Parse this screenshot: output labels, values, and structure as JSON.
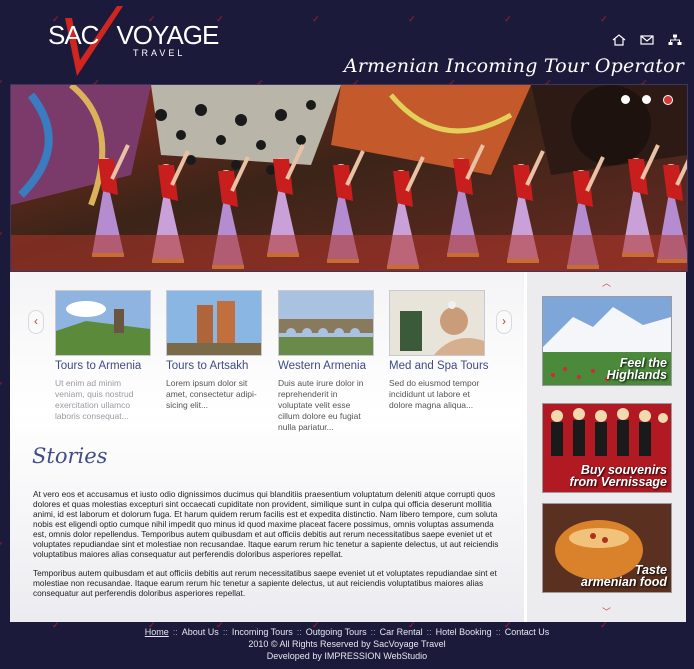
{
  "brand": {
    "name_left": "SAC",
    "name_right": "VOYAGE",
    "sub": "TRAVEL",
    "accent": "#d0261f"
  },
  "watermark_text": "SACVOYAGE",
  "header": {
    "tagline": "Armenian Incoming Tour Operator",
    "icons": [
      "home-icon",
      "mail-icon",
      "sitemap-icon"
    ]
  },
  "slider": {
    "dots": 3,
    "active_dot": 3
  },
  "tours": [
    {
      "title": "Tours to Armenia",
      "desc": "Ut enim ad minim veniam, quis nostrud exercitation ullamco laboris consequat..."
    },
    {
      "title": "Tours to Artsakh",
      "desc": "Lorem ipsum dolor sit amet, consectetur adipi-sicing elit..."
    },
    {
      "title": "Western Armenia",
      "desc": "Duis aute irure dolor in reprehenderit in voluptate velit esse cillum dolore eu fugiat nulla pariatur..."
    },
    {
      "title": "Med and Spa Tours",
      "desc": "Sed do eiusmod tempor incididunt ut labore et dolore magna aliqua..."
    }
  ],
  "stories": {
    "title": "Stories",
    "p1": "At vero eos et accusamus et iusto odio dignissimos ducimus qui blanditiis praesentium voluptatum deleniti atque corrupti quos dolores et quas molestias excepturi sint occaecati cupiditate non provident, similique sunt in culpa qui officia deserunt mollitia animi, id est laborum et dolorum fuga. Et harum quidem rerum facilis est et expedita distinctio. Nam libero tempore, cum soluta nobis est eligendi optio cumque nihil impedit quo minus id quod maxime placeat facere possimus, omnis voluptas assumenda est, omnis dolor repellendus. Temporibus autem quibusdam et aut officiis debitis aut rerum necessitatibus saepe eveniet ut et voluptates repudiandae sint et molestiae non recusandae. Itaque earum rerum hic tenetur a sapiente delectus, ut aut reiciendis voluptatibus maiores alias consequatur aut perferendis doloribus asperiores repellat.",
    "p2": "Temporibus autem quibusdam et aut officiis debitis aut rerum necessitatibus saepe eveniet ut et voluptates repudiandae sint et molestiae non recusandae. Itaque earum rerum hic tenetur a sapiente delectus, ut aut reiciendis voluptatibus maiores alias consequatur aut perferendis doloribus asperiores repellat."
  },
  "promos": [
    {
      "line1": "Feel the",
      "line2": "Highlands"
    },
    {
      "line1": "Buy souvenirs",
      "line2": "from Vernissage"
    },
    {
      "line1": "Taste",
      "line2": "armenian food"
    }
  ],
  "footer": {
    "links": [
      "Home",
      "About Us",
      "Incoming Tours",
      "Outgoing Tours",
      "Car Rental",
      "Hotel Booking",
      "Contact Us"
    ],
    "active": "Home",
    "copyright": "2010 © All Rights Reserved by SacVoyage Travel",
    "developer": "Developed by IMPRESSION WebStudio"
  }
}
